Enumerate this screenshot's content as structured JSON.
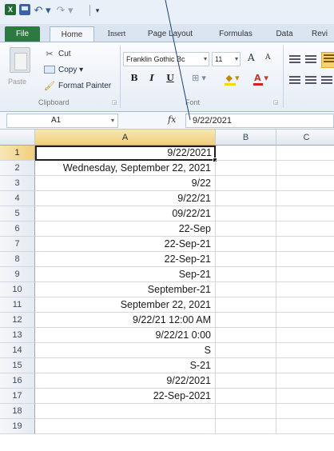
{
  "quick_access": {
    "app_icon": "X",
    "undo_glyph": "↶ ▾",
    "redo_glyph": "↷ ▾",
    "customize_glyph": "▾"
  },
  "ribbon_tabs": [
    {
      "label": "File"
    },
    {
      "label": "Home"
    },
    {
      "label": "Insert"
    },
    {
      "label": "Page Layout"
    },
    {
      "label": "Formulas"
    },
    {
      "label": "Data"
    },
    {
      "label": "Revi"
    }
  ],
  "clipboard": {
    "paste_label": "Paste",
    "cut_label": "Cut",
    "copy_label": "Copy ▾",
    "format_painter_label": "Format Painter",
    "group_label": "Clipboard"
  },
  "font": {
    "font_name": "Franklin Gothic Bc",
    "font_size": "11",
    "grow_label": "A",
    "shrink_label": "A",
    "bold_label": "B",
    "italic_label": "I",
    "underline_label": "U",
    "border_label": "⊞ ▾",
    "fill_label": "◆ ▾",
    "font_color_label": "A ▾",
    "group_label": "Font"
  },
  "formula_bar": {
    "name_box": "A1",
    "fx_label": "fx",
    "formula": "9/22/2021"
  },
  "grid": {
    "columns": [
      "A",
      "B",
      "C"
    ],
    "rows": [
      {
        "num": "1",
        "a": "9/22/2021"
      },
      {
        "num": "2",
        "a": "Wednesday, September 22, 2021"
      },
      {
        "num": "3",
        "a": "9/22"
      },
      {
        "num": "4",
        "a": "9/22/21"
      },
      {
        "num": "5",
        "a": "09/22/21"
      },
      {
        "num": "6",
        "a": "22-Sep"
      },
      {
        "num": "7",
        "a": "22-Sep-21"
      },
      {
        "num": "8",
        "a": "22-Sep-21"
      },
      {
        "num": "9",
        "a": "Sep-21"
      },
      {
        "num": "10",
        "a": "September-21"
      },
      {
        "num": "11",
        "a": "September 22, 2021"
      },
      {
        "num": "12",
        "a": "9/22/21 12:00 AM"
      },
      {
        "num": "13",
        "a": "9/22/21 0:00"
      },
      {
        "num": "14",
        "a": "S"
      },
      {
        "num": "15",
        "a": "S-21"
      },
      {
        "num": "16",
        "a": "9/22/2021"
      },
      {
        "num": "17",
        "a": "22-Sep-2021"
      },
      {
        "num": "18",
        "a": ""
      },
      {
        "num": "19",
        "a": ""
      }
    ]
  }
}
